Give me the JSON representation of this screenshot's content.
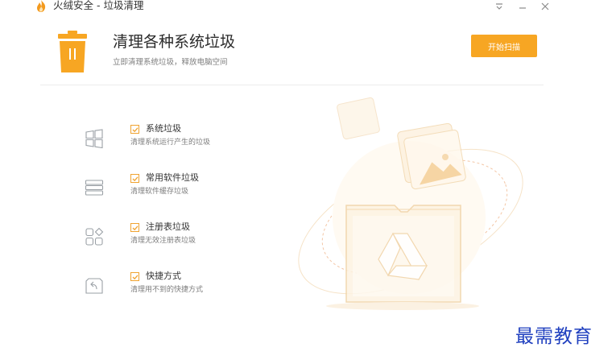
{
  "window": {
    "title": "火绒安全 - 垃圾清理"
  },
  "header": {
    "title": "清理各种系统垃圾",
    "subtitle": "立即清理系统垃圾，释放电脑空间",
    "scan_button": "开始扫描"
  },
  "categories": [
    {
      "label": "系统垃圾",
      "description": "清理系统运行产生的垃圾",
      "checked": true,
      "icon": "windows-icon"
    },
    {
      "label": "常用软件垃圾",
      "description": "清理软件缓存垃圾",
      "checked": true,
      "icon": "software-icon"
    },
    {
      "label": "注册表垃圾",
      "description": "清理无效注册表垃圾",
      "checked": true,
      "icon": "registry-icon"
    },
    {
      "label": "快捷方式",
      "description": "清理用不到的快捷方式",
      "checked": true,
      "icon": "shortcut-icon"
    }
  ],
  "watermark": "最需教育",
  "colors": {
    "accent": "#f7a623",
    "checkbox": "#f0a330"
  }
}
